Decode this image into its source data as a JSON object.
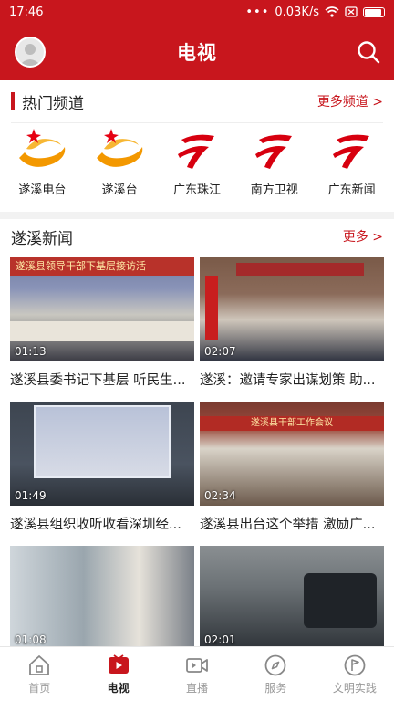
{
  "status_bar": {
    "time": "17:46",
    "speed": "0.03K/s"
  },
  "app_bar": {
    "title": "电视"
  },
  "channels": {
    "header": "热门频道",
    "more": "更多频道 >",
    "items": [
      {
        "name": "遂溪电台",
        "logo": "suixi-logo-icon"
      },
      {
        "name": "遂溪台",
        "logo": "suixi-logo-icon"
      },
      {
        "name": "广东珠江",
        "logo": "guangdong-tv-logo-icon"
      },
      {
        "name": "南方卫视",
        "logo": "guangdong-tv-logo-icon"
      },
      {
        "name": "广东新闻",
        "logo": "guangdong-tv-logo-icon"
      }
    ]
  },
  "news": {
    "header": "遂溪新闻",
    "more": "更多 >",
    "items": [
      {
        "title": "遂溪县委书记下基层 听民生...",
        "duration": "01:13",
        "banner": "遂溪县领导干部下基层接访活"
      },
      {
        "title": "遂溪：邀请专家出谋划策 助...",
        "duration": "02:07"
      },
      {
        "title": "遂溪县组织收听收看深圳经...",
        "duration": "01:49"
      },
      {
        "title": "遂溪县出台这个举措 激励广...",
        "duration": "02:34",
        "banner": "遂溪县干部工作会议"
      },
      {
        "title": "",
        "duration": "01:08"
      },
      {
        "title": "",
        "duration": "02:01"
      }
    ]
  },
  "tab_bar": {
    "items": [
      {
        "label": "首页",
        "icon": "home-icon"
      },
      {
        "label": "电视",
        "icon": "tv-play-icon"
      },
      {
        "label": "直播",
        "icon": "live-camera-icon"
      },
      {
        "label": "服务",
        "icon": "compass-icon"
      },
      {
        "label": "文明实践",
        "icon": "flag-icon"
      }
    ],
    "active": "电视"
  },
  "colors": {
    "brand_red": "#c8161d",
    "accent_orange": "#f39800"
  }
}
